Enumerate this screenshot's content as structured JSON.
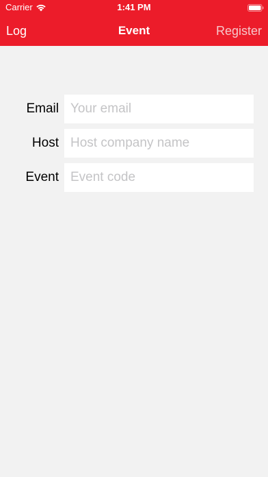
{
  "status_bar": {
    "carrier": "Carrier",
    "time": "1:41 PM",
    "wifi_icon": "wifi-icon",
    "battery_icon": "battery-icon"
  },
  "nav": {
    "left_label": "Log",
    "title": "Event",
    "right_label": "Register"
  },
  "form": {
    "email": {
      "label": "Email",
      "placeholder": "Your email",
      "value": ""
    },
    "host": {
      "label": "Host",
      "placeholder": "Host company name",
      "value": ""
    },
    "event": {
      "label": "Event",
      "placeholder": "Event code",
      "value": ""
    }
  },
  "colors": {
    "brand_red": "#ec1c2a",
    "background": "#f2f2f2",
    "input_background": "#ffffff",
    "placeholder": "#c4c4c6",
    "disabled_nav_text": "#f6c7ca"
  }
}
